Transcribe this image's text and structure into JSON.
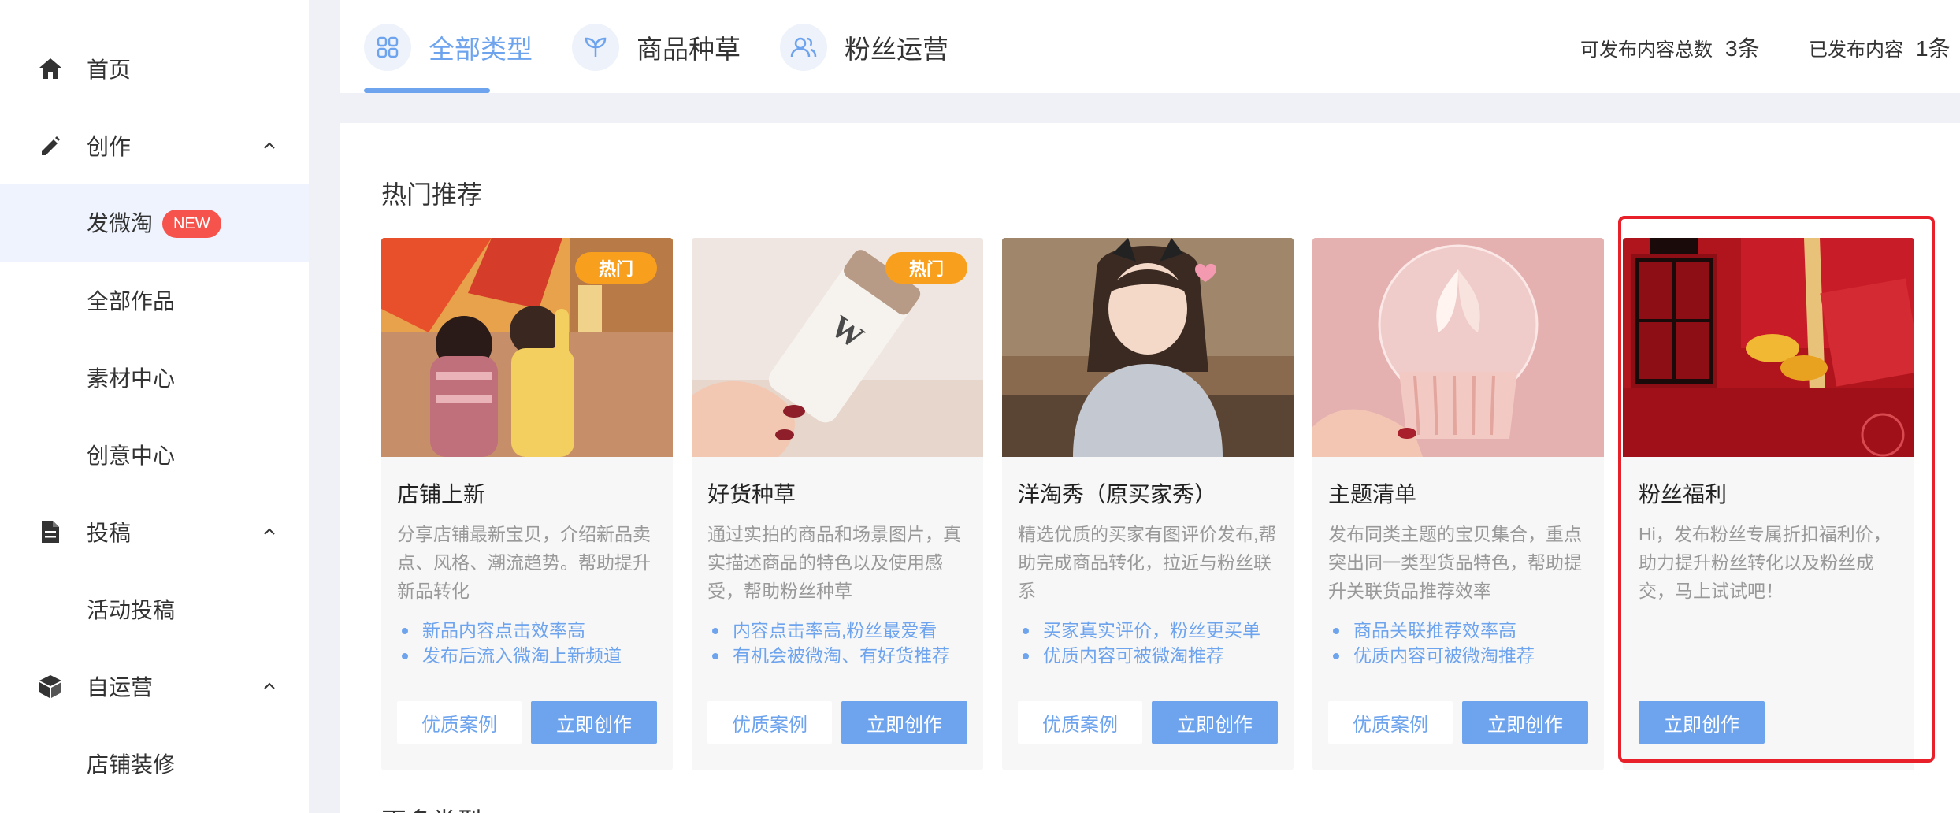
{
  "sidebar": {
    "items": [
      {
        "label": "首页"
      },
      {
        "label": "创作"
      },
      {
        "label": "发微淘",
        "badge": "NEW"
      },
      {
        "label": "全部作品"
      },
      {
        "label": "素材中心"
      },
      {
        "label": "创意中心"
      },
      {
        "label": "投稿"
      },
      {
        "label": "活动投稿"
      },
      {
        "label": "自运营"
      },
      {
        "label": "店铺装修"
      }
    ]
  },
  "header": {
    "tabs": [
      {
        "label": "全部类型",
        "icon": "grid-icon"
      },
      {
        "label": "商品种草",
        "icon": "sprout-icon"
      },
      {
        "label": "粉丝运营",
        "icon": "users-icon"
      }
    ],
    "stats": [
      {
        "label": "可发布内容总数",
        "value": "3条"
      },
      {
        "label": "已发布内容",
        "value": "1条"
      }
    ]
  },
  "main": {
    "section_title": "热门推荐",
    "section_title_2": "更多类型",
    "cards": [
      {
        "title": "店铺上新",
        "hot": "热门",
        "desc": "分享店铺最新宝贝，介绍新品卖点、风格、潮流趋势。帮助提升新品转化",
        "bullets": [
          "新品内容点击效率高",
          "发布后流入微淘上新频道"
        ],
        "case_label": "优质案例",
        "create_label": "立即创作"
      },
      {
        "title": "好货种草",
        "hot": "热门",
        "desc": "通过实拍的商品和场景图片，真实描述商品的特色以及使用感受，帮助粉丝种草",
        "bullets": [
          "内容点击率高,粉丝最爱看",
          "有机会被微淘、有好货推荐"
        ],
        "case_label": "优质案例",
        "create_label": "立即创作"
      },
      {
        "title": "洋淘秀（原买家秀）",
        "desc": "精选优质的买家有图评价发布,帮助完成商品转化，拉近与粉丝联系",
        "bullets": [
          "买家真实评价，粉丝更买单",
          "优质内容可被微淘推荐"
        ],
        "case_label": "优质案例",
        "create_label": "立即创作"
      },
      {
        "title": "主题清单",
        "desc": "发布同类主题的宝贝集合，重点突出同一类型货品特色，帮助提升关联货品推荐效率",
        "bullets": [
          "商品关联推荐效率高",
          "优质内容可被微淘推荐"
        ],
        "case_label": "优质案例",
        "create_label": "立即创作"
      },
      {
        "title": "粉丝福利",
        "desc": "Hi，发布粉丝专属折扣福利价，助力提升粉丝转化以及粉丝成交，马上试试吧！",
        "create_label": "立即创作"
      }
    ]
  },
  "colors": {
    "accent": "#6ea4ee",
    "hot_badge": "#f8a01d",
    "new_badge": "#f5534b",
    "highlight": "#e8202a"
  }
}
